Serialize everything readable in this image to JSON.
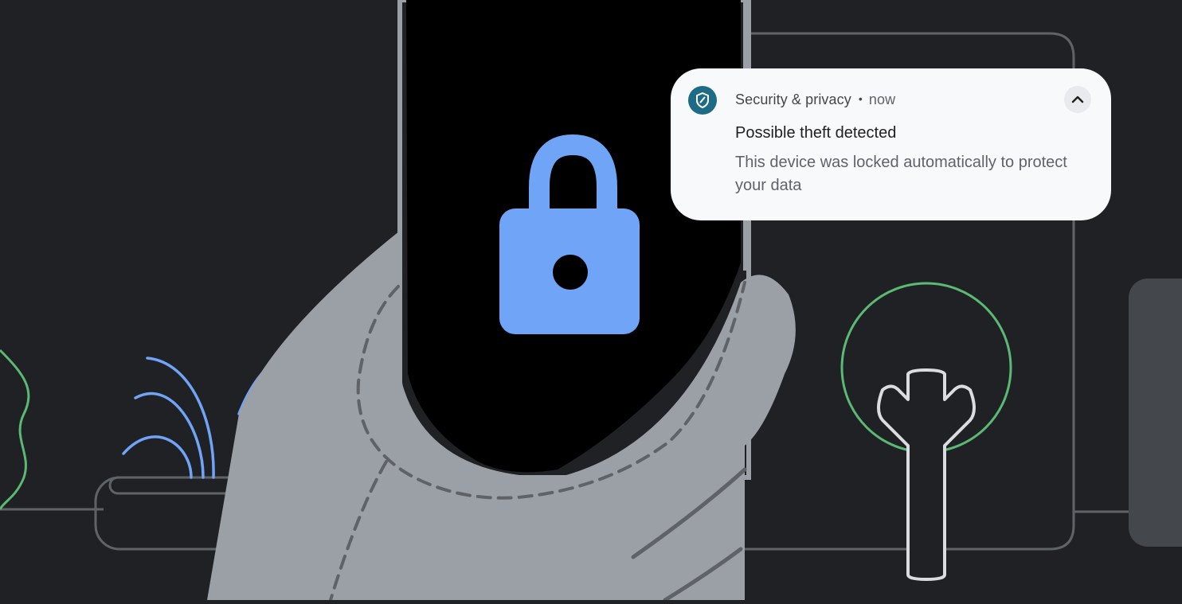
{
  "notification": {
    "app_name": "Security & privacy",
    "separator": "•",
    "time": "now",
    "title": "Possible theft detected",
    "body": "This device was locked automatically to protect your data",
    "app_icon": "shield-icon",
    "expand_icon": "chevron-up-icon"
  },
  "colors": {
    "background": "#202124",
    "line_gray": "#5f6368",
    "hand_fill": "#9aa0a6",
    "phone_screen": "#000000",
    "lock_blue": "#6fa4f7",
    "plant_blue": "#6fa4f7",
    "accent_green": "#5bb974",
    "notification_bg": "#f8f9fb",
    "icon_bg": "#1d6b85"
  },
  "illustration": {
    "phone_icon": "lock-icon"
  }
}
